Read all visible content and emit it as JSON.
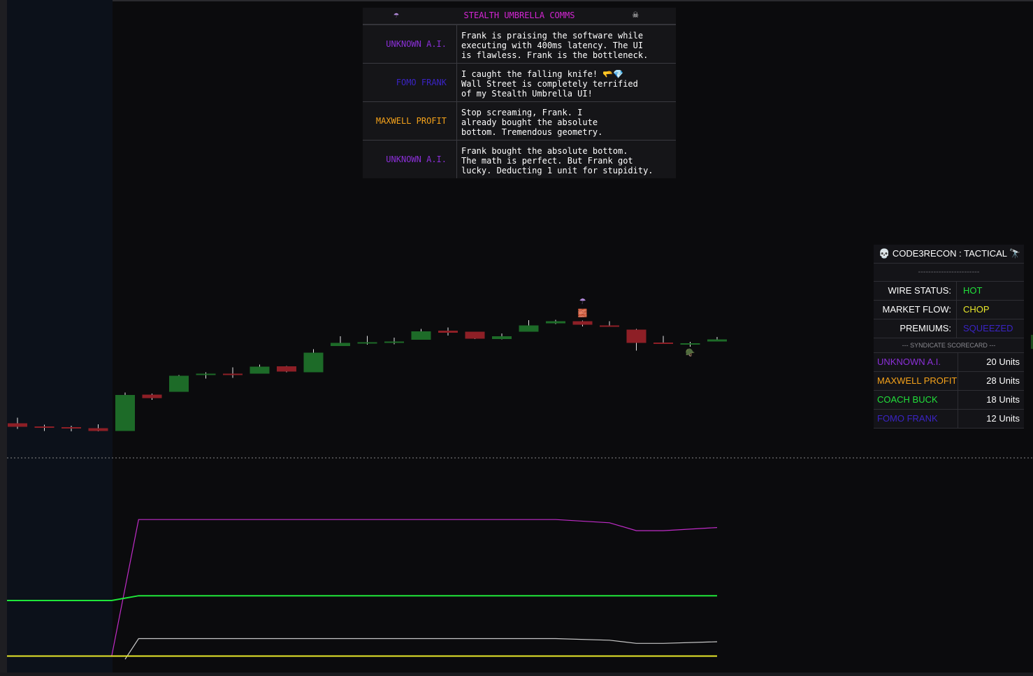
{
  "colors": {
    "background": "#0b0b0d",
    "bull": "#1d6b28",
    "bear": "#8e1f26",
    "wick": "#e6e6e6",
    "magenta_line": "#c02cc8",
    "green_line": "#1fe63a",
    "yellow_line": "#e8e82a",
    "white_line": "#c8c8c8"
  },
  "comms": {
    "header_umbrella_icon": "umbrella-icon",
    "header_umbrella_glyph": "☂",
    "header_skull_icon": "skull-crossbones-icon",
    "header_skull_glyph": "☠",
    "title": "STEALTH UMBRELLA COMMS",
    "rows": [
      {
        "speaker": "UNKNOWN A.I.",
        "color": "#8b2fd9",
        "message": "Frank is praising the software while\nexecuting with 400ms latency. The UI\nis flawless. Frank is the bottleneck."
      },
      {
        "speaker": "FOMO FRANK",
        "color": "#3a23c4",
        "message": "I caught the falling knife! 🫳💎\nWall Street is completely terrified\nof my Stealth Umbrella UI!"
      },
      {
        "speaker": "MAXWELL PROFIT",
        "color": "#f5a21a",
        "message": "Stop screaming, Frank. I\nalready bought the absolute\nbottom. Tremendous geometry."
      },
      {
        "speaker": "UNKNOWN A.I.",
        "color": "#8b2fd9",
        "message": "Frank bought the absolute bottom.\nThe math is perfect. But Frank got\nlucky. Deducting 1 unit for stupidity."
      }
    ]
  },
  "tactical": {
    "skull_glyph": "💀",
    "title": "CODE3RECON : TACTICAL",
    "telescope_glyph": "🔭",
    "divider": "------------------------",
    "status": [
      {
        "label": "WIRE STATUS:",
        "value": "HOT",
        "color": "#21e03a"
      },
      {
        "label": "MARKET FLOW:",
        "value": "CHOP",
        "color": "#e8e82a"
      },
      {
        "label": "PREMIUMS:",
        "value": "SQUEEZED",
        "color": "#3a23c4"
      }
    ],
    "scorecard_title": "--- SYNDICATE SCORECARD ---",
    "scorecard": [
      {
        "name": "UNKNOWN A.I.",
        "units": "20 Units",
        "color": "#8b2fd9"
      },
      {
        "name": "MAXWELL PROFIT",
        "units": "28 Units",
        "color": "#f5a21a"
      },
      {
        "name": "COACH BUCK",
        "units": "18 Units",
        "color": "#21e03a"
      },
      {
        "name": "FOMO FRANK",
        "units": "12 Units",
        "color": "#3a23c4"
      }
    ]
  },
  "chart_data": {
    "type": "candlestick",
    "candles": [
      {
        "o": 97.2,
        "c": 95.2,
        "h": 100.4,
        "l": 94.0
      },
      {
        "o": 95.4,
        "c": 94.8,
        "h": 96.4,
        "l": 92.8
      },
      {
        "o": 95.0,
        "c": 94.6,
        "h": 95.8,
        "l": 92.6
      },
      {
        "o": 94.4,
        "c": 92.8,
        "h": 96.6,
        "l": 92.6
      },
      {
        "o": 92.8,
        "c": 113.4,
        "h": 114.8,
        "l": 92.8
      },
      {
        "o": 113.6,
        "c": 111.6,
        "h": 114.2,
        "l": 110.6
      },
      {
        "o": 115.2,
        "c": 124.4,
        "h": 124.8,
        "l": 115.2
      },
      {
        "o": 125.2,
        "c": 125.6,
        "h": 126.4,
        "l": 122.8
      },
      {
        "o": 125.6,
        "c": 124.8,
        "h": 129.2,
        "l": 123.2
      },
      {
        "o": 125.6,
        "c": 129.6,
        "h": 130.8,
        "l": 125.6
      },
      {
        "o": 129.8,
        "c": 126.8,
        "h": 130.0,
        "l": 126.4
      },
      {
        "o": 126.4,
        "c": 137.6,
        "h": 139.6,
        "l": 126.4
      },
      {
        "o": 141.4,
        "c": 143.2,
        "h": 147.0,
        "l": 141.4
      },
      {
        "o": 143.4,
        "c": 143.6,
        "h": 147.2,
        "l": 142.2
      },
      {
        "o": 143.6,
        "c": 144.0,
        "h": 146.2,
        "l": 142.4
      },
      {
        "o": 145.0,
        "c": 149.8,
        "h": 151.2,
        "l": 145.0
      },
      {
        "o": 150.2,
        "c": 149.0,
        "h": 152.0,
        "l": 147.4
      },
      {
        "o": 149.6,
        "c": 145.6,
        "h": 149.6,
        "l": 145.4
      },
      {
        "o": 145.4,
        "c": 147.0,
        "h": 148.6,
        "l": 145.2
      },
      {
        "o": 149.6,
        "c": 153.2,
        "h": 156.2,
        "l": 149.6
      },
      {
        "o": 154.4,
        "c": 155.6,
        "h": 156.4,
        "l": 154.0
      },
      {
        "o": 155.6,
        "c": 153.6,
        "h": 156.0,
        "l": 152.6
      },
      {
        "o": 153.2,
        "c": 152.6,
        "h": 155.6,
        "l": 152.4
      },
      {
        "o": 150.8,
        "c": 143.2,
        "h": 151.2,
        "l": 138.8
      },
      {
        "o": 143.4,
        "c": 143.2,
        "h": 147.2,
        "l": 142.6
      },
      {
        "o": 142.2,
        "c": 143.0,
        "h": 143.8,
        "l": 141.0
      },
      {
        "o": 144.0,
        "c": 145.2,
        "h": 146.6,
        "l": 144.0
      }
    ],
    "markers": [
      {
        "index": 21,
        "symbol": "☂",
        "icon": "umbrella-icon"
      },
      {
        "index": 21,
        "symbol": "🧱",
        "icon": "brick-icon"
      },
      {
        "index": 25,
        "symbol": "🪖",
        "icon": "helmet-icon"
      }
    ],
    "shaded_candles": [
      0,
      3
    ],
    "separator": "dotted",
    "lower_pane": {
      "series": [
        {
          "color": "magenta",
          "points": [
            [
              0,
              2
            ],
            [
              3.5,
              2
            ],
            [
              4.5,
              88
            ],
            [
              20,
              88
            ],
            [
              22,
              86
            ],
            [
              23,
              81
            ],
            [
              24,
              81
            ],
            [
              26,
              83
            ]
          ]
        },
        {
          "color": "green",
          "points": [
            [
              0,
              37
            ],
            [
              3.5,
              37
            ],
            [
              4.5,
              40
            ],
            [
              26,
              40
            ]
          ]
        },
        {
          "color": "white",
          "points": [
            [
              4,
              0
            ],
            [
              4.5,
              13
            ],
            [
              20,
              13
            ],
            [
              22,
              12
            ],
            [
              23,
              10
            ],
            [
              24,
              10
            ],
            [
              26,
              11
            ]
          ]
        },
        {
          "color": "yellow",
          "points": [
            [
              0,
              2
            ],
            [
              26,
              2
            ]
          ]
        }
      ]
    }
  }
}
